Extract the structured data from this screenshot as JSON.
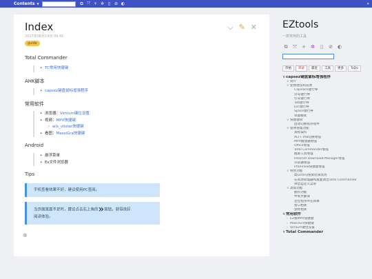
{
  "topbar": {
    "contents_label": "Contents",
    "caret": "▼",
    "tool_icons": [
      {
        "name": "copy-icon",
        "glyph": "⧉"
      },
      {
        "name": "expand-icon",
        "glyph": "⤧"
      },
      {
        "name": "plus-icon",
        "glyph": "+"
      },
      {
        "name": "gear-icon",
        "glyph": "✲"
      },
      {
        "name": "document-icon",
        "glyph": "▯"
      },
      {
        "name": "check-icon",
        "glyph": "⊘"
      },
      {
        "name": "contrast-icon",
        "glyph": "◐"
      }
    ],
    "collapse_glyph": "»"
  },
  "page": {
    "title": "Index",
    "date": "2017年06月19日 09:41",
    "tag": "guide",
    "sections": {
      "tc_heading": "Total Commander",
      "tc_link": "TC常用快捷键",
      "ahk_heading": "AHK脚本",
      "ahk_link": "capsez键盘鼠标增强程序",
      "soft_heading": "常用软件",
      "browser_prefix": "浏览器：",
      "browser_link": "Vimium键位设置",
      "video_prefix": "视频：",
      "video_link": "MPV快捷键",
      "wlx_link": "wlx_vlister快捷键",
      "view_prefix": "看图：",
      "view_link": "MassiGra快捷键",
      "android_heading": "Android",
      "android_item1": "悬浮菜单",
      "android_item2": "Es文件浏览器",
      "tips_heading": "Tips",
      "tip1": "手机查看效果不好，建议使用PC查阅。",
      "tip2_a": "当页面宽度不足时，建议点击右上角的",
      "tip2_glyph": "»",
      "tip2_b": "按钮，获得良好",
      "tip2_c": "阅读体验。"
    },
    "add_glyph": "⊕",
    "icons": {
      "collapse": "⌵",
      "edit": "✎",
      "close": "✕"
    }
  },
  "sidebar": {
    "title": "EZtools",
    "subtitle": "一款常用的工具",
    "tool_icons": [
      {
        "name": "copy-icon",
        "glyph": "⧉",
        "color": "#777"
      },
      {
        "name": "expand-icon",
        "glyph": "⤧",
        "color": "#777"
      },
      {
        "name": "plus-icon",
        "glyph": "+",
        "color": "#3aa83a"
      },
      {
        "name": "gear-icon",
        "glyph": "✲",
        "color": "#8a3ac4"
      },
      {
        "name": "document-icon",
        "glyph": "▯",
        "color": "#777"
      },
      {
        "name": "check-icon",
        "glyph": "⊘",
        "color": "#777"
      },
      {
        "name": "contrast-icon",
        "glyph": "◐",
        "color": "#777"
      }
    ],
    "tabs": [
      "开始",
      "目录",
      "最近",
      "工具",
      "更多",
      "ToDo"
    ],
    "active_tab": 1,
    "tree": [
      {
        "label": "capsez键盘鼠标增强程序",
        "level": 0,
        "arrow": "∨",
        "bold": true
      },
      {
        "label": "简介",
        "level": 1,
        "arrow": "∨"
      },
      {
        "label": "使用建议和说明",
        "level": 1,
        "arrow": "∨"
      },
      {
        "label": "Capslock键行导",
        "level": 2,
        "arrow": ""
      },
      {
        "label": "分号键行导",
        "level": 2,
        "arrow": ""
      },
      {
        "label": "引号键行导",
        "level": 2,
        "arrow": ""
      },
      {
        "label": "Tab键行导",
        "level": 2,
        "arrow": ""
      },
      {
        "label": "Esc键行导",
        "level": 2,
        "arrow": ""
      },
      {
        "label": "Space键行导",
        "level": 2,
        "arrow": ""
      },
      {
        "label": "单键模式",
        "level": 2,
        "arrow": ""
      },
      {
        "label": "快捷键目",
        "level": 1,
        "arrow": "∨"
      },
      {
        "label": "启动切换程序组件",
        "level": 2,
        "arrow": ""
      },
      {
        "label": "窗体管理功能",
        "level": 1,
        "arrow": "∨"
      },
      {
        "label": "某标操作",
        "level": 2,
        "arrow": ""
      },
      {
        "label": "ALT+TAB切换增强",
        "level": 2,
        "arrow": ""
      },
      {
        "label": "MPV播放器增强",
        "level": 2,
        "arrow": ""
      },
      {
        "label": "Office增强",
        "level": 2,
        "arrow": ""
      },
      {
        "label": "Total Commander增强",
        "level": 2,
        "arrow": ""
      },
      {
        "label": "截屏工具增强",
        "level": 2,
        "arrow": ""
      },
      {
        "label": "Internet Download Manager增强",
        "level": 2,
        "arrow": ""
      },
      {
        "label": "浏览器增强",
        "level": 2,
        "arrow": ""
      },
      {
        "label": "IrfanView快捷键增强",
        "level": 2,
        "arrow": ""
      },
      {
        "label": "特色功能",
        "level": 1,
        "arrow": "∨"
      },
      {
        "label": "类Listary搜索结果高亮",
        "level": 2,
        "arrow": ""
      },
      {
        "label": "在资源管理器和桌面调出Total Commander",
        "level": 2,
        "arrow": ""
      },
      {
        "label": "弹出自定义菜单",
        "level": 2,
        "arrow": ""
      },
      {
        "label": "高级功能",
        "level": 1,
        "arrow": "∨"
      },
      {
        "label": "翻页功能",
        "level": 2,
        "arrow": ""
      },
      {
        "label": "中英文翻译",
        "level": 2,
        "arrow": ""
      },
      {
        "label": "定位程序所在目录",
        "level": 2,
        "arrow": ""
      },
      {
        "label": "窗口相关",
        "level": 2,
        "arrow": ""
      },
      {
        "label": "鼠标相关",
        "level": 2,
        "arrow": ""
      },
      {
        "label": "常用软件",
        "level": 0,
        "arrow": "∨",
        "bold": true
      },
      {
        "label": "EZ版MPV快捷键",
        "level": 1,
        "arrow": "›"
      },
      {
        "label": "MassiGra快捷键",
        "level": 1,
        "arrow": "›"
      },
      {
        "label": "Vimium键位设置",
        "level": 1,
        "arrow": "›"
      },
      {
        "label": "Total Commander",
        "level": 0,
        "arrow": "∨",
        "bold": true
      }
    ]
  },
  "colors": {
    "accent": "#3d53c4",
    "link": "#3d6fd8",
    "tag": "#f2c94c",
    "tip": "#cfe5fb"
  }
}
